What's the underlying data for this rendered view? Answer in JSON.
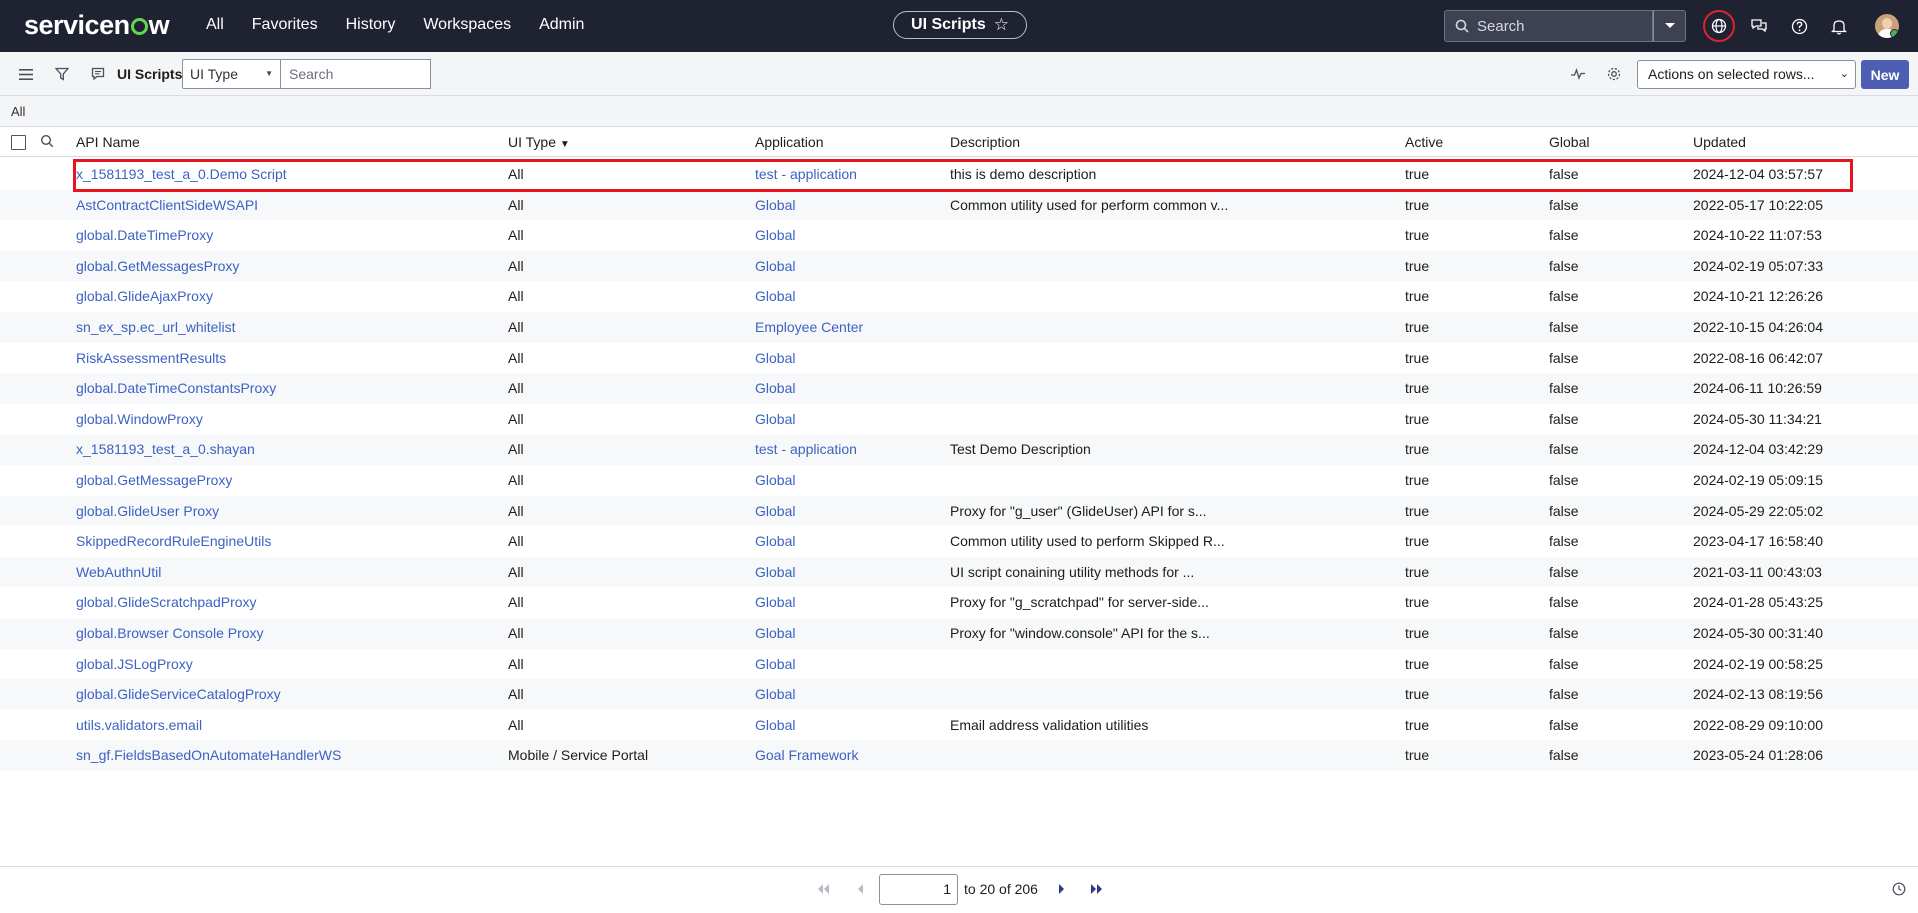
{
  "nav": {
    "brand": "servicenow",
    "menu": [
      "All",
      "Favorites",
      "History",
      "Workspaces",
      "Admin"
    ],
    "context_title": "UI Scripts",
    "search_placeholder": "Search"
  },
  "toolbar": {
    "title": "UI Scripts",
    "field_select": "UI Type",
    "search_placeholder": "Search",
    "actions_label": "Actions on selected rows...",
    "new_label": "New"
  },
  "breadcrumb": "All",
  "columns": [
    "API Name",
    "UI Type",
    "Application",
    "Description",
    "Active",
    "Global",
    "Updated"
  ],
  "rows": [
    {
      "name": "x_1581193_test_a_0.Demo Script",
      "type": "All",
      "app": "test - application",
      "desc": "this is demo description",
      "active": "true",
      "global": "false",
      "updated": "2024-12-04 03:57:57"
    },
    {
      "name": "AstContractClientSideWSAPI",
      "type": "All",
      "app": "Global",
      "desc": "Common utility used for perform common v...",
      "active": "true",
      "global": "false",
      "updated": "2022-05-17 10:22:05"
    },
    {
      "name": "global.DateTimeProxy",
      "type": "All",
      "app": "Global",
      "desc": "",
      "active": "true",
      "global": "false",
      "updated": "2024-10-22 11:07:53"
    },
    {
      "name": "global.GetMessagesProxy",
      "type": "All",
      "app": "Global",
      "desc": "",
      "active": "true",
      "global": "false",
      "updated": "2024-02-19 05:07:33"
    },
    {
      "name": "global.GlideAjaxProxy",
      "type": "All",
      "app": "Global",
      "desc": "",
      "active": "true",
      "global": "false",
      "updated": "2024-10-21 12:26:26"
    },
    {
      "name": "sn_ex_sp.ec_url_whitelist",
      "type": "All",
      "app": "Employee Center",
      "desc": "",
      "active": "true",
      "global": "false",
      "updated": "2022-10-15 04:26:04"
    },
    {
      "name": "RiskAssessmentResults",
      "type": "All",
      "app": "Global",
      "desc": "",
      "active": "true",
      "global": "false",
      "updated": "2022-08-16 06:42:07"
    },
    {
      "name": "global.DateTimeConstantsProxy",
      "type": "All",
      "app": "Global",
      "desc": "",
      "active": "true",
      "global": "false",
      "updated": "2024-06-11 10:26:59"
    },
    {
      "name": "global.WindowProxy",
      "type": "All",
      "app": "Global",
      "desc": "",
      "active": "true",
      "global": "false",
      "updated": "2024-05-30 11:34:21"
    },
    {
      "name": "x_1581193_test_a_0.shayan",
      "type": "All",
      "app": "test - application",
      "desc": "Test Demo Description",
      "active": "true",
      "global": "false",
      "updated": "2024-12-04 03:42:29"
    },
    {
      "name": "global.GetMessageProxy",
      "type": "All",
      "app": "Global",
      "desc": "",
      "active": "true",
      "global": "false",
      "updated": "2024-02-19 05:09:15"
    },
    {
      "name": "global.GlideUser Proxy",
      "type": "All",
      "app": "Global",
      "desc": "Proxy for \"g_user\" (GlideUser) API for s...",
      "active": "true",
      "global": "false",
      "updated": "2024-05-29 22:05:02"
    },
    {
      "name": "SkippedRecordRuleEngineUtils",
      "type": "All",
      "app": "Global",
      "desc": "Common utility used to perform Skipped R...",
      "active": "true",
      "global": "false",
      "updated": "2023-04-17 16:58:40"
    },
    {
      "name": "WebAuthnUtil",
      "type": "All",
      "app": "Global",
      "desc": "UI script conaining utility methods for ...",
      "active": "true",
      "global": "false",
      "updated": "2021-03-11 00:43:03"
    },
    {
      "name": "global.GlideScratchpadProxy",
      "type": "All",
      "app": "Global",
      "desc": "Proxy for \"g_scratchpad\" for server-side...",
      "active": "true",
      "global": "false",
      "updated": "2024-01-28 05:43:25"
    },
    {
      "name": "global.Browser Console Proxy",
      "type": "All",
      "app": "Global",
      "desc": "Proxy for \"window.console\" API for the s...",
      "active": "true",
      "global": "false",
      "updated": "2024-05-30 00:31:40"
    },
    {
      "name": "global.JSLogProxy",
      "type": "All",
      "app": "Global",
      "desc": "",
      "active": "true",
      "global": "false",
      "updated": "2024-02-19 00:58:25"
    },
    {
      "name": "global.GlideServiceCatalogProxy",
      "type": "All",
      "app": "Global",
      "desc": "",
      "active": "true",
      "global": "false",
      "updated": "2024-02-13 08:19:56"
    },
    {
      "name": "utils.validators.email",
      "type": "All",
      "app": "Global",
      "desc": "Email address validation utilities",
      "active": "true",
      "global": "false",
      "updated": "2022-08-29 09:10:00"
    },
    {
      "name": "sn_gf.FieldsBasedOnAutomateHandlerWS",
      "type": "Mobile / Service Portal",
      "app": "Goal Framework",
      "desc": "",
      "active": "true",
      "global": "false",
      "updated": "2023-05-24 01:28:06"
    }
  ],
  "pagination": {
    "current": "1",
    "range_text": "to 20 of 206"
  },
  "colors": {
    "nav_bg": "#1f2231",
    "link": "#3c62c2",
    "primary_button": "#4e5eb2",
    "highlight": "#e5161e"
  }
}
